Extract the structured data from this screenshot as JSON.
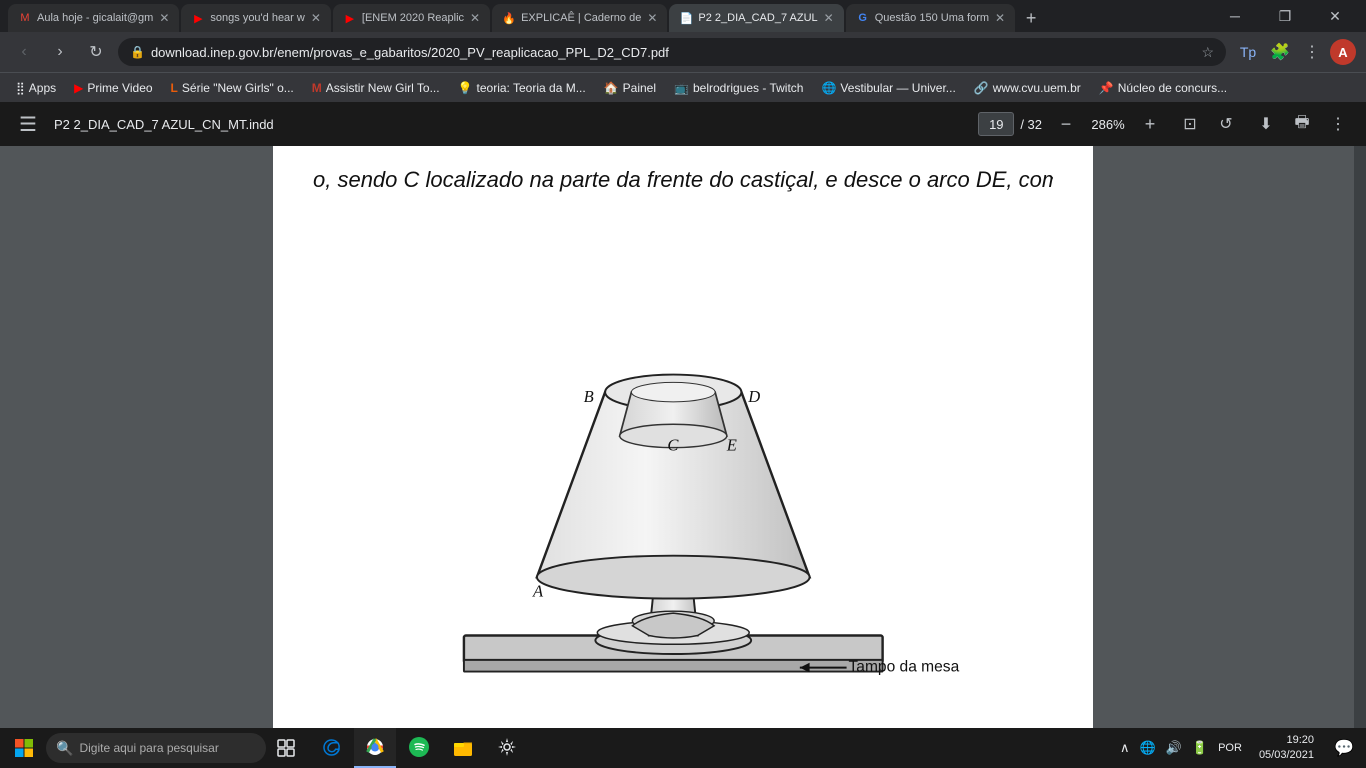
{
  "browser": {
    "tabs": [
      {
        "id": "tab1",
        "favicon": "M",
        "favicon_color": "#EA4335",
        "label": "Aula hoje - gicalait@gm",
        "active": false
      },
      {
        "id": "tab2",
        "favicon": "▶",
        "favicon_color": "#FF0000",
        "label": "songs you'd hear w",
        "active": false
      },
      {
        "id": "tab3",
        "favicon": "▶",
        "favicon_color": "#FF0000",
        "label": "[ENEM 2020 Reaplic",
        "active": false
      },
      {
        "id": "tab4",
        "favicon": "🔥",
        "favicon_color": "#FF8C00",
        "label": "EXPLICAÊ | Caderno de",
        "active": false
      },
      {
        "id": "tab5",
        "favicon": "📄",
        "favicon_color": "#1a73e8",
        "label": "P2 2_DIA_CAD_7 AZUL",
        "active": true
      },
      {
        "id": "tab6",
        "favicon": "G",
        "favicon_color": "#4285F4",
        "label": "Questão 150 Uma form",
        "active": false
      }
    ],
    "url": "download.inep.gov.br/enem/provas_e_gabaritos/2020_PV_reaplicacao_PPL_D2_CD7.pdf",
    "bookmarks": [
      {
        "favicon": "⣿",
        "label": "Apps"
      },
      {
        "favicon": "▶",
        "label": "Prime Video"
      },
      {
        "favicon": "L",
        "label": "Série \"New Girls\" o..."
      },
      {
        "favicon": "M",
        "label": "Assistir New Girl To..."
      },
      {
        "favicon": "💡",
        "label": "teoria: Teoria da M..."
      },
      {
        "favicon": "🏠",
        "label": "Painel"
      },
      {
        "favicon": "📺",
        "label": "belrodrigues - Twitch"
      },
      {
        "favicon": "🌐",
        "label": "Vestibular — Univer..."
      },
      {
        "favicon": "🔗",
        "label": "www.cvu.uem.br"
      },
      {
        "favicon": "📌",
        "label": "Núcleo de concurs..."
      }
    ]
  },
  "pdf_viewer": {
    "title": "P2 2_DIA_CAD_7 AZUL_CN_MT.indd",
    "current_page": "19",
    "total_pages": "32",
    "zoom": "286%",
    "page_label": "/ 32"
  },
  "pdf_content": {
    "partial_text": "o, sendo C localizado na parte da frente do castiçal, e desce o arco DE, como repr",
    "tampo_label": "Tampo da mesa",
    "points": {
      "A": "A",
      "B": "B",
      "C": "C",
      "D": "D",
      "E": "E"
    }
  },
  "taskbar": {
    "search_placeholder": "Digite aqui para pesquisar",
    "apps": [
      {
        "id": "windows",
        "icon": "⊞",
        "active": false
      },
      {
        "id": "edge",
        "icon": "e",
        "active": false
      },
      {
        "id": "pdf_app",
        "icon": "📄",
        "active": true
      },
      {
        "id": "spotify",
        "icon": "🎵",
        "active": false
      },
      {
        "id": "explorer",
        "icon": "📁",
        "active": false
      },
      {
        "id": "settings",
        "icon": "⚙",
        "active": false
      }
    ],
    "time": "19:20",
    "date": "05/03/2021",
    "language": "POR"
  }
}
